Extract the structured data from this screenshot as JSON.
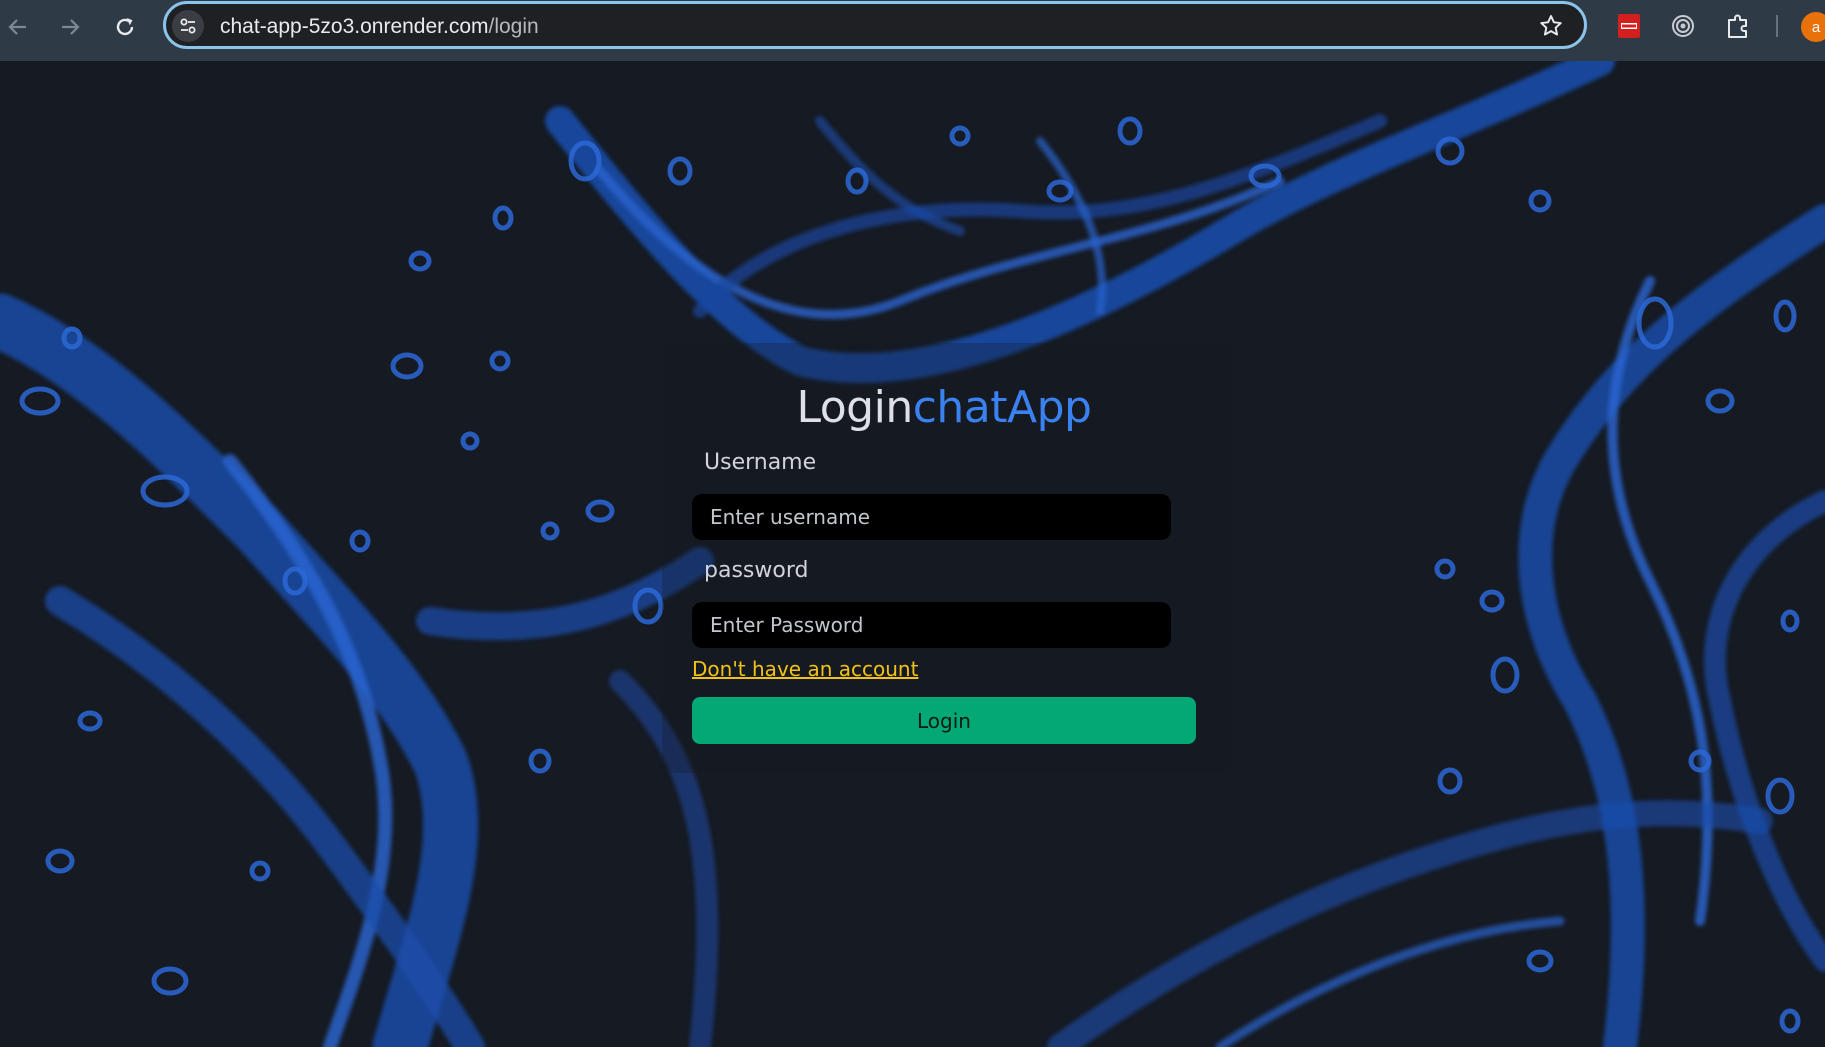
{
  "browser": {
    "url_host": "chat-app-5zo3.onrender.com",
    "url_path": "/login",
    "avatar_letter": "a",
    "extensions": [
      "pdf-extension-icon",
      "record-extension-icon",
      "extensions-puzzle-icon"
    ]
  },
  "login": {
    "title_part1": "Login",
    "title_part2": "chatApp",
    "username_label": "Username",
    "username_placeholder": "Enter username",
    "password_label": "password",
    "password_placeholder": "Enter Password",
    "signup_link": "Don't have an account",
    "login_button": "Login"
  },
  "colors": {
    "page_bg": "#161a22",
    "splash": "#1d54b8",
    "accent_title": "#3a82f0",
    "link": "#f3c218",
    "button": "#04a874"
  }
}
